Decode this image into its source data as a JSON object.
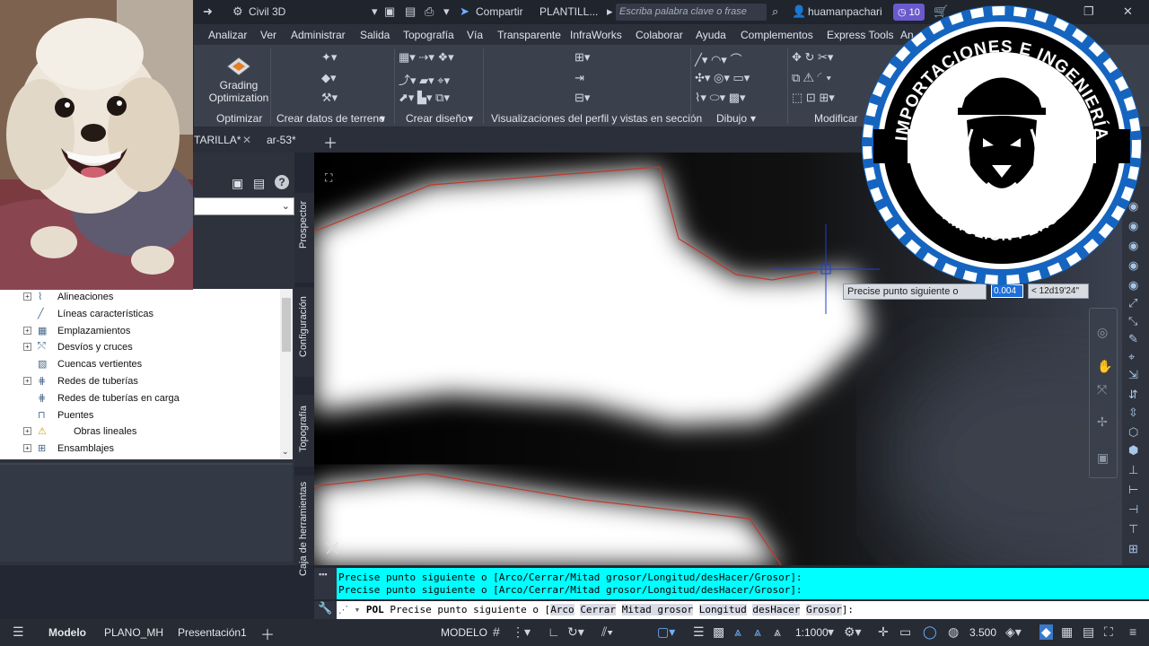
{
  "titlebar": {
    "workspace": "Civil 3D",
    "share": "Compartir",
    "filename": "PLANTILL...",
    "search_placeholder": "Escriba palabra clave o frase",
    "user": "huamanpachari",
    "notifications": "10"
  },
  "ribbon_tabs": [
    "Analizar",
    "Ver",
    "Administrar",
    "Salida",
    "Topografía",
    "Vía",
    "Transparente",
    "InfraWorks",
    "Colaborar",
    "Ayuda",
    "Complementos",
    "Express Tools",
    "An"
  ],
  "ribbon": {
    "grading_label": "Grading Optimization",
    "panels": {
      "optimizar": "Optimizar",
      "terreno": "Crear datos de terreno",
      "diseno": "Crear diseño",
      "perfil": "Visualizaciones del perfil y vistas en sección",
      "dibujo": "Dibujo",
      "modificar": "Modificar"
    }
  },
  "doc_tabs": {
    "active": "TARILLA*",
    "other": "ar-53*"
  },
  "toolspace": {
    "vertical_tabs": [
      "Prospector",
      "Configuración",
      "Topografía",
      "Caja de herramientas"
    ],
    "tree": [
      {
        "label": "Alineaciones",
        "icon": "alignment-icon",
        "expandable": true
      },
      {
        "label": "Líneas características",
        "icon": "feature-line-icon",
        "expandable": false
      },
      {
        "label": "Emplazamientos",
        "icon": "site-icon",
        "expandable": true
      },
      {
        "label": "Desvíos y cruces",
        "icon": "intersection-icon",
        "expandable": true
      },
      {
        "label": "Cuencas vertientes",
        "icon": "catchment-icon",
        "expandable": false
      },
      {
        "label": "Redes de tuberías",
        "icon": "pipe-network-icon",
        "expandable": true
      },
      {
        "label": "Redes de tuberías en carga",
        "icon": "pressure-network-icon",
        "expandable": false
      },
      {
        "label": "Puentes",
        "icon": "bridge-icon",
        "expandable": false
      },
      {
        "label": "Obras lineales",
        "icon": "corridor-warning-icon",
        "expandable": true
      },
      {
        "label": "Ensamblajes",
        "icon": "assembly-icon",
        "expandable": true
      }
    ]
  },
  "drawing": {
    "tooltip": "Precise punto siguiente o",
    "distance_input": "0.004",
    "angle": "< 12d19'24\""
  },
  "command_line": {
    "history_1": "Precise punto siguiente o [Arco/Cerrar/Mitad grosor/Longitud/desHacer/Grosor]:",
    "history_2": "Precise punto siguiente o [Arco/Cerrar/Mitad grosor/Longitud/desHacer/Grosor]:",
    "prompt_cmd": "POL",
    "prompt_text": "Precise punto siguiente o [",
    "options": [
      "Arco",
      "Cerrar",
      "Mitad grosor",
      "Longitud",
      "desHacer",
      "Grosor"
    ],
    "prompt_end": "]:"
  },
  "statusbar": {
    "tabs": [
      "Modelo",
      "PLANO_MH",
      "Presentación1"
    ],
    "mode": "MODELO",
    "scale": "1:1000",
    "elevation": "3.500"
  },
  "logo": {
    "top_text": "IMPORTACIONES E INGENIERÍA",
    "bottom_text": "HP FORMULION PERÚ - 2001"
  },
  "colors": {
    "accent": "#1565c0",
    "cmd_history_bg": "#00ffff",
    "polyline": "#c0392b"
  }
}
